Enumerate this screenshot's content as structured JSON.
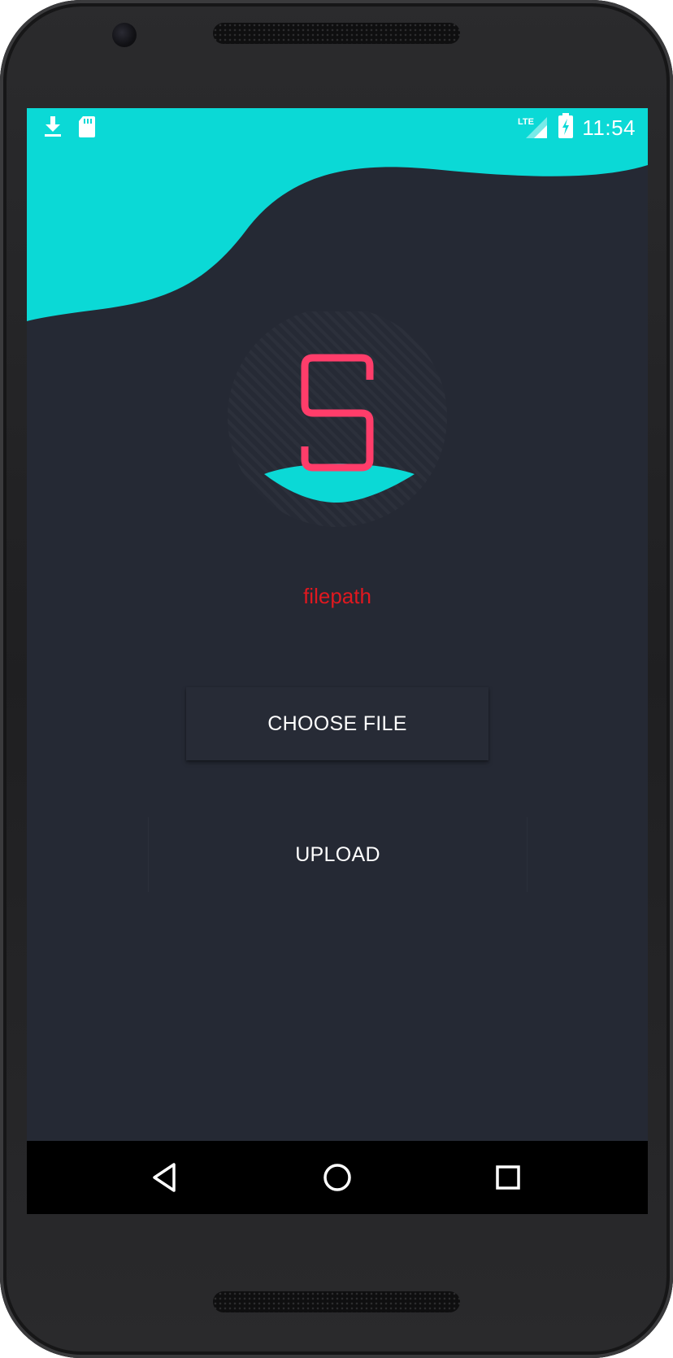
{
  "status_bar": {
    "time": "11:54",
    "network_label": "LTE",
    "left_icons": [
      "download-icon",
      "sd-card-icon"
    ],
    "right_icons": [
      "lte-signal-icon",
      "battery-charging-icon"
    ]
  },
  "main": {
    "logo_letter": "S",
    "filepath_text": "filepath",
    "choose_file_label": "CHOOSE FILE",
    "upload_label": "UPLOAD"
  },
  "nav_bar": {
    "buttons": [
      "back-icon",
      "home-icon",
      "recents-icon"
    ]
  },
  "colors": {
    "accent": "#0bd9d6",
    "background": "#252934",
    "logo": "#ff3d6a",
    "filepath_text": "#e0181f",
    "button_text": "#ffffff"
  }
}
